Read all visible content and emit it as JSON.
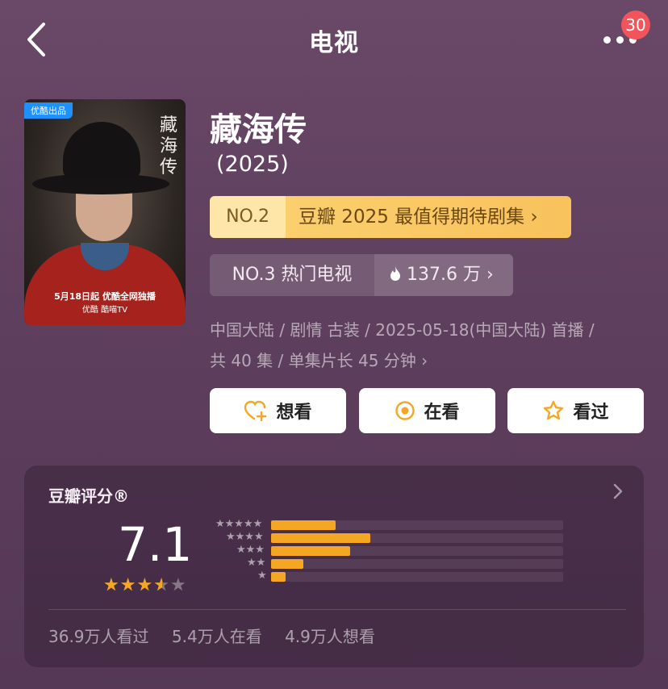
{
  "header": {
    "title": "电视",
    "badge_count": "30"
  },
  "poster": {
    "tag": "优酷出品",
    "vertical_title": "藏海传",
    "date_text": "5月18日起 优酷全网独播",
    "brand_text": "优酷  酷喵TV"
  },
  "show": {
    "title": "藏海传",
    "year": "(2025)",
    "rank1_no": "NO.2",
    "rank1_text": "豆瓣 2025 最值得期待剧集 ›",
    "rank2_text": "NO.3 热门电视",
    "rank2_heat": "137.6 万 ›",
    "meta_line1": "中国大陆 / 剧情 古装 / 2025-05-18(中国大陆) 首播 /",
    "meta_line2": "共 40 集 / 单集片长 45 分钟 ›"
  },
  "actions": {
    "want_label": "想看",
    "watching_label": "在看",
    "watched_label": "看过"
  },
  "rating": {
    "label": "豆瓣评分®",
    "score": "7.1",
    "stars_value": 3.5,
    "star_rows": [
      "★★★★★",
      "★★★★",
      "★★★",
      "★★",
      "★"
    ],
    "distribution": [
      0.22,
      0.34,
      0.27,
      0.11,
      0.05
    ]
  },
  "stats": {
    "watched": "36.9万人看过",
    "watching": "5.4万人在看",
    "want": "4.9万人想看"
  },
  "colors": {
    "accent": "#f5a623",
    "badge": "#f2545b",
    "rank_gold": "#fbcf6e"
  }
}
